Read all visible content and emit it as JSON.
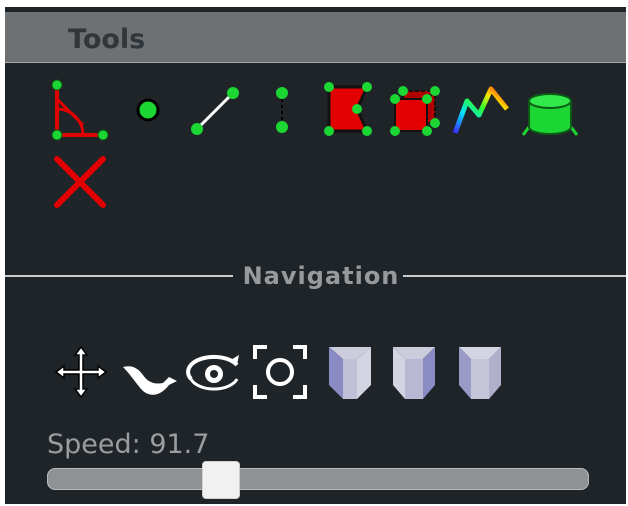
{
  "window": {
    "title": "Tools"
  },
  "tools": [
    {
      "name": "angle-measure-tool",
      "icon": "angle-icon"
    },
    {
      "name": "point-tool",
      "icon": "point-icon"
    },
    {
      "name": "line-tool",
      "icon": "line-icon"
    },
    {
      "name": "vertical-distance-tool",
      "icon": "vertical-distance-icon"
    },
    {
      "name": "area-tool",
      "icon": "area-icon"
    },
    {
      "name": "volume-tool",
      "icon": "volume-icon"
    },
    {
      "name": "height-profile-tool",
      "icon": "height-profile-icon"
    },
    {
      "name": "cylinder-tool",
      "icon": "cylinder-icon"
    },
    {
      "name": "remove-all-tool",
      "icon": "close-icon"
    }
  ],
  "navigation": {
    "label": "Navigation",
    "controls": [
      {
        "name": "earth-controls",
        "icon": "move-arrows-icon"
      },
      {
        "name": "fly-controls",
        "icon": "bird-icon"
      },
      {
        "name": "orbit-controls",
        "icon": "orbit-eye-icon"
      },
      {
        "name": "focus-controls",
        "icon": "focus-icon"
      },
      {
        "name": "left-view",
        "icon": "cube-left-icon"
      },
      {
        "name": "front-view",
        "icon": "cube-front-icon"
      },
      {
        "name": "top-view",
        "icon": "cube-top-icon"
      }
    ],
    "speed": {
      "label": "Speed: 91.7",
      "fraction": 0.32
    }
  },
  "colors": {
    "panel_bg": "#1f2428",
    "titlebar_bg": "#6d7174",
    "accent_green": "#1bd633",
    "accent_red": "#e30000"
  }
}
